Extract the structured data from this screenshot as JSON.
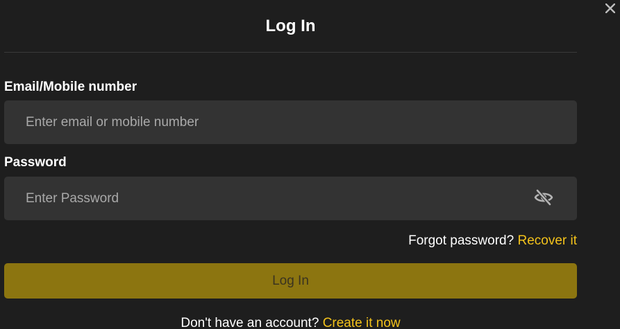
{
  "modal": {
    "title": "Log In",
    "close_icon": "close-icon"
  },
  "form": {
    "email": {
      "label": "Email/Mobile number",
      "placeholder": "Enter email or mobile number",
      "value": ""
    },
    "password": {
      "label": "Password",
      "placeholder": "Enter Password",
      "value": "",
      "toggle_icon": "eye-off-icon"
    },
    "forgot": {
      "text": "Forgot password?",
      "link": "Recover it"
    },
    "submit_label": "Log In"
  },
  "footer": {
    "text": "Don't have an account?",
    "link": "Create it now"
  },
  "colors": {
    "background": "#1e1e1e",
    "field_background": "#333333",
    "accent": "#f3c21b",
    "button_background": "#8c7510"
  }
}
